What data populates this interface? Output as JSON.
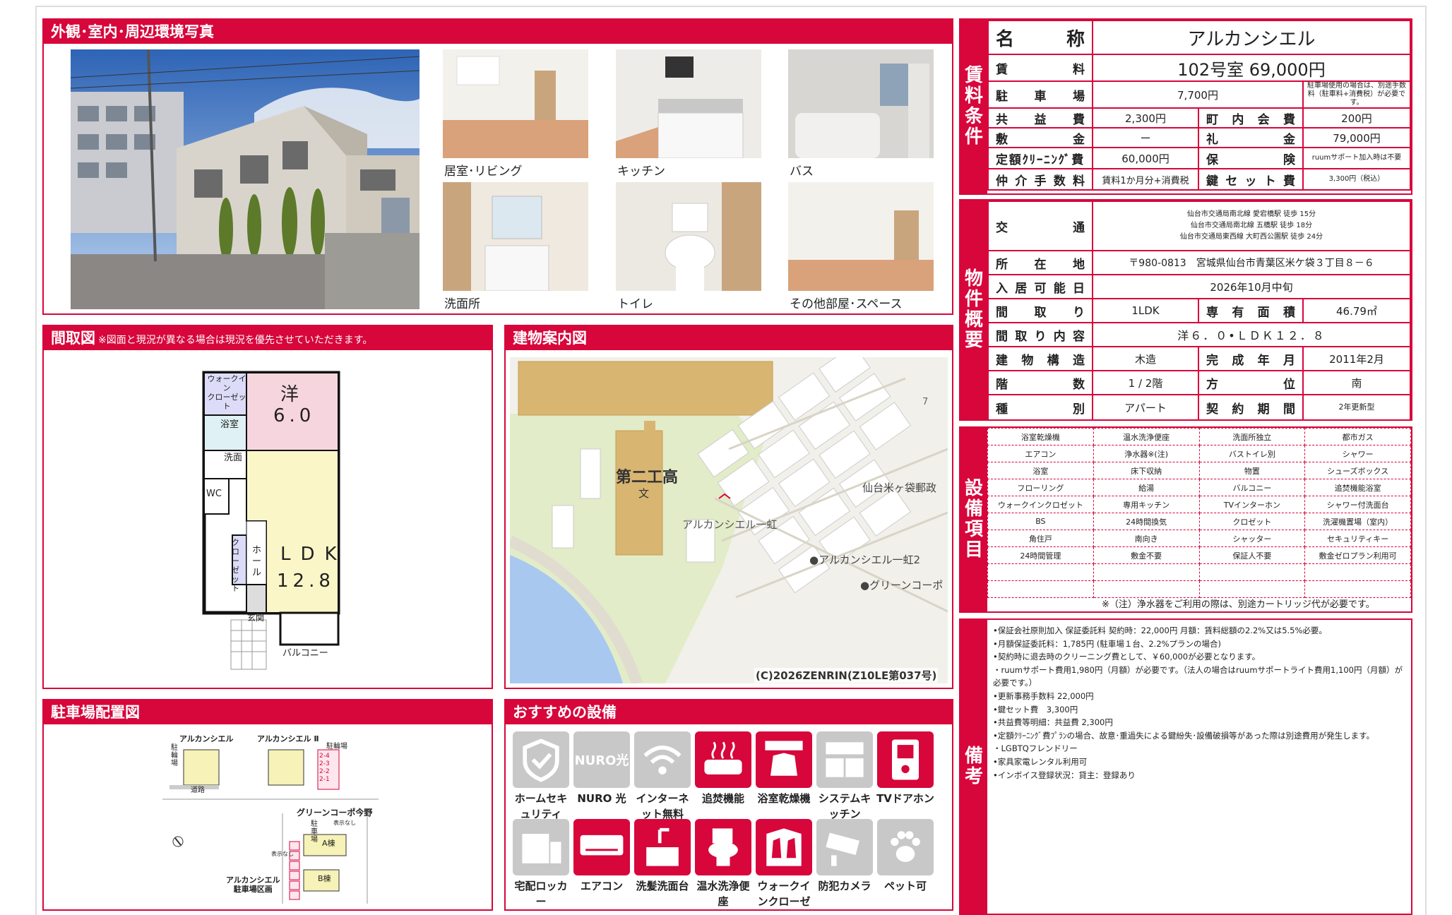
{
  "sections": {
    "photos": "外観･室内･周辺環境写真",
    "floorplan": "間取図",
    "floorplan_note": "※図面と現況が異なる場合は現況を優先させていただきます。",
    "map": "建物案内図",
    "parking": "駐車場配置図",
    "recommended": "おすすめの設備"
  },
  "photo_captions": [
    "居室･リビング",
    "キッチン",
    "バス",
    "洗面所",
    "トイレ",
    "その他部屋･スペース"
  ],
  "floorplan_labels": {
    "walkin": "ウォークイン\nクローゼット",
    "western": "洋",
    "western_size": "6.0",
    "bath": "浴室",
    "washroom": "洗面",
    "wc": "WC",
    "closet": "クローゼット",
    "hall": "ホール",
    "ldk": "LDK",
    "ldk_size": "12.8",
    "entrance": "玄関",
    "balcony": "バルコニー"
  },
  "map_labels": {
    "school": "第二工高",
    "school_mark": "文",
    "target": "アルカンシエル一虹",
    "post": "仙台米ヶ袋郵政",
    "b2": "●アルカンシエル一虹2",
    "green": "●グリーンコーポ",
    "copyright": "(C)2026ZENRIN(Z10LE第037号)",
    "num7": "7"
  },
  "parking_labels": {
    "a1": "アルカンシエル",
    "a2": "アルカンシエル Ⅱ",
    "road": "道路",
    "green": "グリーンコーポ今野",
    "a_bldg": "A棟",
    "b_bldg": "B棟",
    "lot": "アルカンシエル\n駐車場区画",
    "bike1": "駐輪場",
    "bike2": "駐輪場",
    "bike3": "駐車場",
    "nodisp1": "表示なし",
    "nodisp2": "表示なし",
    "slots": [
      "2-4",
      "2-3",
      "2-2",
      "2-1"
    ]
  },
  "conditions": {
    "label": "賃料条件",
    "name_h": "名称",
    "name": "アルカンシエル",
    "rent_h": "賃料",
    "rent": "102号室 69,000円",
    "parking_h": "駐車場",
    "parking": "7,700円",
    "parking_note": "駐車場使用の場合は、別途手数料（駐車料+消費税）が必要です。",
    "common_h": "共益費",
    "common": "2,300円",
    "town_h": "町内会費",
    "town": "200円",
    "deposit_h": "敷金",
    "deposit": "ー",
    "key_money_h": "礼金",
    "key_money": "79,000円",
    "cleaning_h": "定額ｸﾘｰﾆﾝｸﾞ費",
    "cleaning": "60,000円",
    "insurance_h": "保険",
    "insurance": "ruumサポート加入時は不要",
    "brokerage_h": "仲介手数料",
    "brokerage": "賃料1か月分+消費税",
    "keyset_h": "鍵セット費",
    "keyset": "3,300円（税込）"
  },
  "overview": {
    "label": "物件概要",
    "transport_h": "交通",
    "transport": [
      "仙台市交通局南北線 愛宕橋駅 徒歩 15分",
      "仙台市交通局南北線 五橋駅 徒歩 18分",
      "仙台市交通局東西線 大町西公園駅 徒歩 24分"
    ],
    "address_h": "所在地",
    "address": "〒980-0813　宮城県仙台市青葉区米ケ袋３丁目８－６",
    "movein_h": "入居可能日",
    "movein": "2026年10月中旬",
    "layout_h": "間取り",
    "layout": "1LDK",
    "area_h": "専有面積",
    "area": "46.79㎡",
    "detail_h": "間取り内容",
    "detail": "洋６．０•ＬＤＫ１２．８",
    "structure_h": "建物構造",
    "structure": "木造",
    "built_h": "完成年月",
    "built": "2011年2月",
    "floor_h": "階数",
    "floor": "1 / 2階",
    "direction_h": "方位",
    "direction": "南",
    "type_h": "種別",
    "type": "アパート",
    "contract_h": "契約期間",
    "contract": "2年更新型"
  },
  "equipment": {
    "label": "設備項目",
    "rows": [
      [
        "浴室乾燥機",
        "温水洗浄便座",
        "洗面所独立",
        "都市ガス"
      ],
      [
        "エアコン",
        "浄水器※(注)",
        "バストイレ別",
        "シャワー"
      ],
      [
        "浴室",
        "床下収納",
        "物置",
        "シューズボックス"
      ],
      [
        "フローリング",
        "給湯",
        "バルコニー",
        "追焚機能浴室"
      ],
      [
        "ウォークインクロゼット",
        "専用キッチン",
        "TVインターホン",
        "シャワー付洗面台"
      ],
      [
        "BS",
        "24時間換気",
        "クロゼット",
        "洗濯機置場（室内）"
      ],
      [
        "角住戸",
        "南向き",
        "シャッター",
        "セキュリティキー"
      ],
      [
        "24時間管理",
        "敷金不要",
        "保証人不要",
        "敷金ゼロプラン利用可"
      ]
    ],
    "note": "※（注）浄水器をご利用の際は、別途カートリッジ代が必要です。"
  },
  "remarks": {
    "label": "備考",
    "lines": [
      "•保証会社原則加入 保証委託料 契約時：22,000円 月額：賃料総額の2.2%又は5.5%必要。",
      "•月額保証委託料：1,785円 (駐車場１台、2.2%プランの場合)",
      "•契約時に退去時のクリーニング費として、￥60,000が必要となります。",
      "・ruumサポート費用1,980円（月額）が必要です。（法人の場合はruumサポートライト費用1,100円（月額）が必要です。）",
      "•更新事務手数料 22,000円",
      "•鍵セット費　3,300円",
      "•共益費等明細：共益費 2,300円",
      "•定額ｸﾘｰﾆﾝｸﾞ費ﾌﾟﾗﾝの場合、故意･重過失による鍵紛失･設備破損等があった際は別途費用が発生します。",
      "・LGBTQフレンドリー",
      "•家具家電レンタル利用可",
      "•インボイス登録状況：貸主：登録あり"
    ]
  },
  "recommended_items": [
    {
      "label": "ホームセキュリティ",
      "icon": "shield-icon",
      "on": false
    },
    {
      "label": "NURO 光",
      "icon": "nuro-icon",
      "on": false
    },
    {
      "label": "インターネット無料",
      "icon": "wifi-icon",
      "on": false
    },
    {
      "label": "追焚機能",
      "icon": "bathtub-icon",
      "on": true
    },
    {
      "label": "浴室乾燥機",
      "icon": "bath-dryer-icon",
      "on": true
    },
    {
      "label": "システムキッチン",
      "icon": "kitchen-icon",
      "on": false
    },
    {
      "label": "TVドアホン",
      "icon": "intercom-icon",
      "on": true
    },
    {
      "label": "宅配ロッカー",
      "icon": "locker-icon",
      "on": false
    },
    {
      "label": "エアコン",
      "icon": "aircon-icon",
      "on": true
    },
    {
      "label": "洗髪洗面台",
      "icon": "washbasin-icon",
      "on": true
    },
    {
      "label": "温水洗浄便座",
      "icon": "toilet-icon",
      "on": true
    },
    {
      "label": "ウォークインクローゼット",
      "icon": "closet-icon",
      "on": true
    },
    {
      "label": "防犯カメラ",
      "icon": "camera-icon",
      "on": false
    },
    {
      "label": "ペット可",
      "icon": "paw-icon",
      "on": false
    }
  ],
  "nuro_text": "NURO光"
}
